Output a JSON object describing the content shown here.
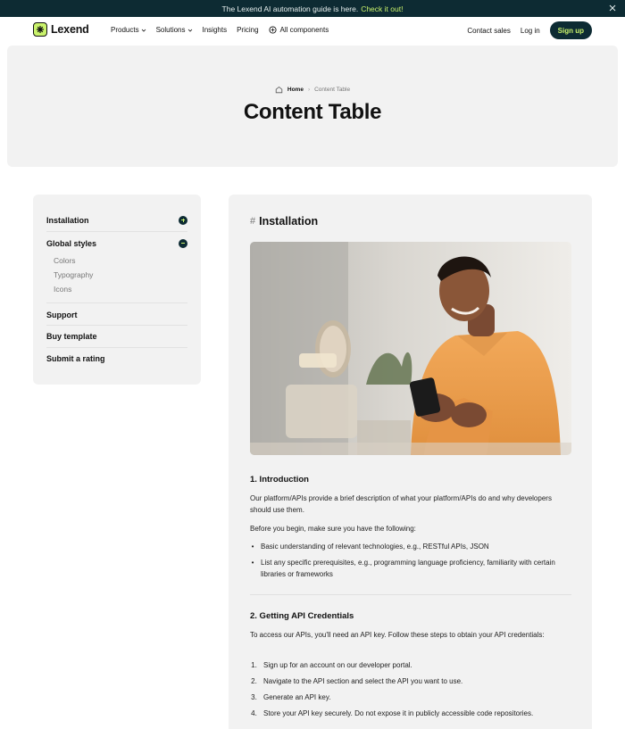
{
  "announcement": {
    "text": "The Lexend AI automation guide is here.",
    "link": "Check it out!",
    "close_icon": "close-icon"
  },
  "nav": {
    "brand": "Lexend",
    "items": [
      {
        "label": "Products",
        "dropdown": true
      },
      {
        "label": "Solutions",
        "dropdown": true
      },
      {
        "label": "Insights",
        "dropdown": false
      },
      {
        "label": "Pricing",
        "dropdown": false
      },
      {
        "label": "All components",
        "icon": "grid-icon"
      }
    ],
    "contact": "Contact sales",
    "login": "Log in",
    "signup": "Sign up"
  },
  "hero": {
    "breadcrumb_home": "Home",
    "breadcrumb_current": "Content Table",
    "title": "Content Table"
  },
  "sidebar": {
    "items": [
      {
        "label": "Installation",
        "state": "collapsed"
      },
      {
        "label": "Global styles",
        "state": "expanded",
        "children": [
          "Colors",
          "Typography",
          "Icons"
        ]
      },
      {
        "label": "Support"
      },
      {
        "label": "Buy template"
      },
      {
        "label": "Submit a rating"
      }
    ]
  },
  "content": {
    "title": "Installation",
    "image_alt": "Smiling man in orange shirt using smartphone",
    "intro_heading": "1. Introduction",
    "intro_para": "Our platform/APIs provide a brief description of what your platform/APIs do and why developers should use them.",
    "before_para": "Before you begin, make sure you have the following:",
    "prereqs": [
      "Basic understanding of relevant technologies, e.g., RESTful APIs, JSON",
      "List any specific prerequisites, e.g., programming language proficiency, familiarity with certain libraries or frameworks"
    ],
    "cred_heading": "2. Getting API Credentials",
    "cred_para": "To access our APIs, you'll need an API key. Follow these steps to obtain your API credentials:",
    "steps": [
      "Sign up for an account on our developer portal.",
      "Navigate to the API section and select the API you want to use.",
      "Generate an API key.",
      "Store your API key securely. Do not expose it in publicly accessible code repositories."
    ]
  },
  "colors": {
    "dark": "#0d2b33",
    "accent": "#c9f26b",
    "panel": "#f2f2f2"
  }
}
